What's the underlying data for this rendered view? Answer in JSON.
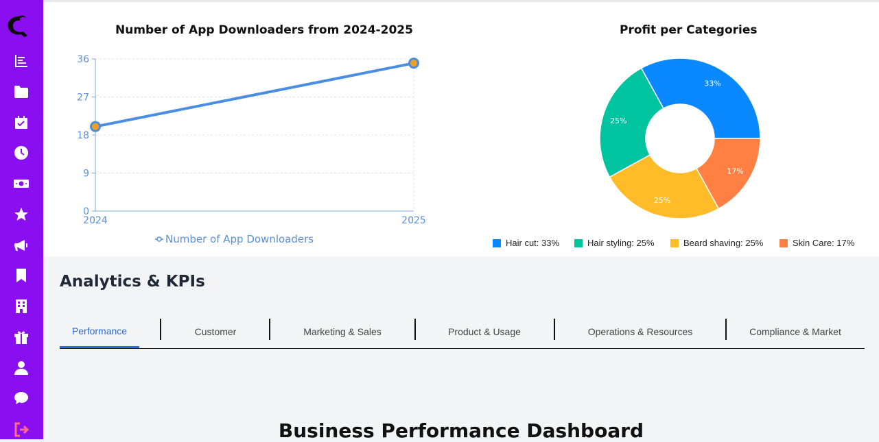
{
  "sidebar": {
    "items": [
      {
        "icon": "logo-icon"
      },
      {
        "icon": "bar-list-icon"
      },
      {
        "icon": "folder-icon"
      },
      {
        "icon": "calendar-check-icon"
      },
      {
        "icon": "clock-icon"
      },
      {
        "icon": "money-icon"
      },
      {
        "icon": "star-icon"
      },
      {
        "icon": "megaphone-icon"
      },
      {
        "icon": "bookmark-icon"
      },
      {
        "icon": "building-icon"
      },
      {
        "icon": "gift-icon"
      },
      {
        "icon": "user-icon"
      },
      {
        "icon": "chat-icon"
      },
      {
        "icon": "logout-icon"
      }
    ],
    "bg_color": "#8a0ff0",
    "logout_color": "#ff6b8a"
  },
  "line_chart_title": "Number of App Downloaders from 2024-2025",
  "pie_chart_title": "Profit per Categories",
  "chart_data": [
    {
      "type": "line",
      "title": "Number of App Downloaders from 2024-2025",
      "x": [
        "2024",
        "2025"
      ],
      "series": [
        {
          "name": "Number of App Downloaders",
          "values": [
            20,
            35
          ],
          "color": "#4a8ee0"
        }
      ],
      "ylim": [
        0,
        36
      ],
      "yticks": [
        "0",
        "9",
        "18",
        "27",
        "36"
      ],
      "grid": true,
      "legend": "bottom"
    },
    {
      "type": "pie",
      "title": "Profit per Categories",
      "labels": [
        "Hair cut",
        "Hair styling",
        "Beard shaving",
        "Skin Care"
      ],
      "values": [
        33,
        25,
        25,
        17
      ],
      "slice_labels": [
        "33%",
        "25%",
        "25%",
        "17%"
      ],
      "legend_labels": [
        "Hair cut: 33%",
        "Hair styling: 25%",
        "Beard shaving: 25%",
        "Skin Care: 17%"
      ],
      "colors": [
        "#0a88ff",
        "#00c49f",
        "#ffbb28",
        "#ff8042"
      ],
      "legend": "bottom"
    }
  ],
  "section_title": "Analytics & KPIs",
  "tabs": [
    {
      "label": "Performance",
      "active": true
    },
    {
      "label": "Customer"
    },
    {
      "label": "Marketing & Sales"
    },
    {
      "label": "Product & Usage"
    },
    {
      "label": "Operations & Resources"
    },
    {
      "label": "Compliance & Market"
    }
  ],
  "dashboard_title": "Business Performance Dashboard"
}
